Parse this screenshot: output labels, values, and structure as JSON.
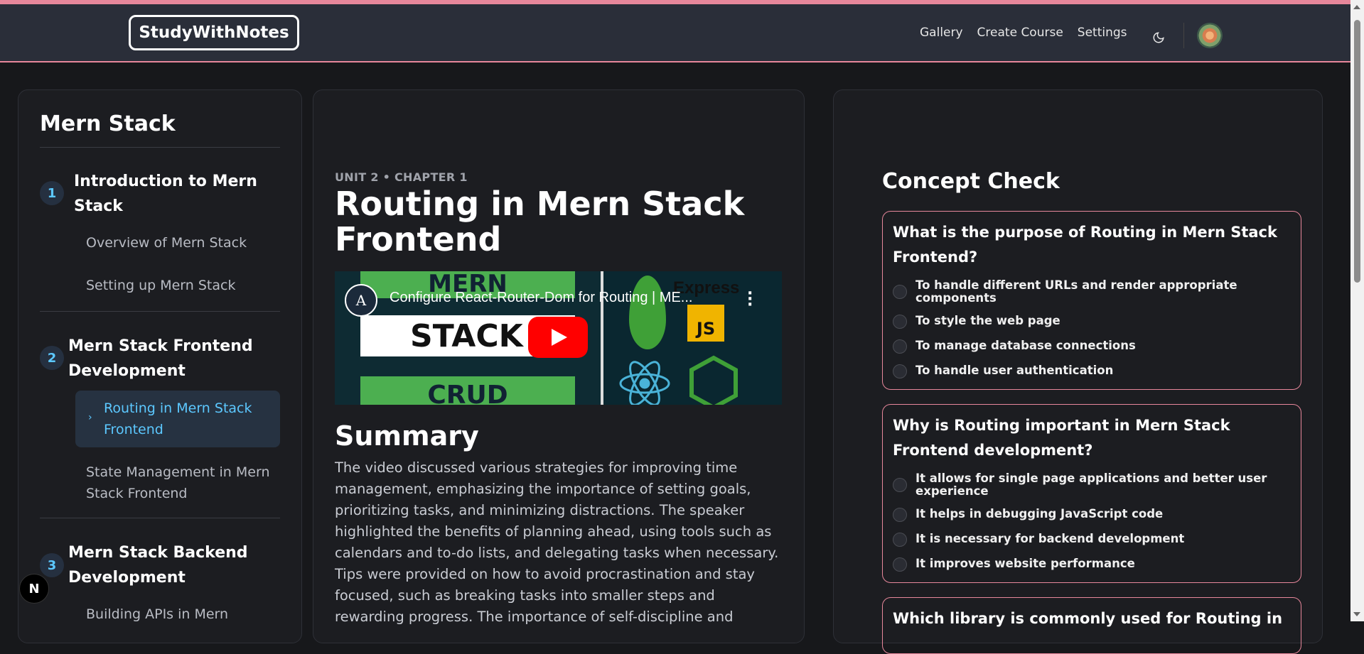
{
  "navbar": {
    "logo": "StudyWithNotes",
    "links": [
      "Gallery",
      "Create Course",
      "Settings"
    ],
    "theme_icon": "moon-icon",
    "avatar_icon": "user-avatar"
  },
  "sidebar": {
    "course_title": "Mern Stack",
    "units": [
      {
        "number": "1",
        "title": "Introduction to Mern Stack",
        "chapters": [
          "Overview of Mern Stack",
          "Setting up Mern Stack"
        ]
      },
      {
        "number": "2",
        "title": "Mern Stack Frontend Development",
        "chapters": [
          "Routing in Mern Stack Frontend",
          "State Management in Mern Stack Frontend"
        ]
      },
      {
        "number": "3",
        "title": "Mern Stack Backend Development",
        "chapters": [
          "Building APIs in Mern"
        ]
      }
    ],
    "active_chapter": "Routing in Mern Stack Frontend"
  },
  "main": {
    "unit_label": "UNIT 2 • CHAPTER 1",
    "chapter_title": "Routing in Mern Stack Frontend",
    "video": {
      "title": "Configure React-Router-Dom for Routing | ME...",
      "channel_initial": "A",
      "thumb_text_top": "MERN",
      "thumb_text_middle": "STACK",
      "thumb_text_bottom": "CRUD",
      "thumb_express": "Express",
      "thumb_js": "JS"
    },
    "summary_heading": "Summary",
    "summary_text": "The video discussed various strategies for improving time management, emphasizing the importance of setting goals, prioritizing tasks, and minimizing distractions. The speaker highlighted the benefits of planning ahead, using tools such as calendars and to-do lists, and delegating tasks when necessary. Tips were provided on how to avoid procrastination and stay focused, such as breaking tasks into smaller steps and rewarding progress. The importance of self-discipline and"
  },
  "concept_check": {
    "title": "Concept Check",
    "questions": [
      {
        "question": "What is the purpose of Routing in Mern Stack Frontend?",
        "options": [
          "To handle different URLs and render appropriate components",
          "To style the web page",
          "To manage database connections",
          "To handle user authentication"
        ]
      },
      {
        "question": "Why is Routing important in Mern Stack Frontend development?",
        "options": [
          "It allows for single page applications and better user experience",
          "It helps in debugging JavaScript code",
          "It is necessary for backend development",
          "It improves website performance"
        ]
      },
      {
        "question": "Which library is commonly used for Routing in",
        "options": []
      }
    ]
  },
  "badge": {
    "label": "N"
  },
  "colors": {
    "accent": "#e7879b",
    "link_blue": "#5cc8ff",
    "background": "#17181b",
    "panel": "#1c1d21",
    "navbar": "#2a2e39"
  }
}
